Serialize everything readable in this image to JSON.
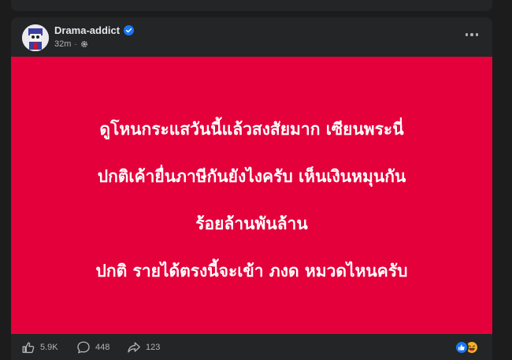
{
  "post": {
    "author": "Drama-addict",
    "time": "32m",
    "separator": "·",
    "content_lines": [
      "ดูโหนกระแสวันนี้แล้วสงสัยมาก เซียนพระนี่",
      "ปกติเค้ายื่นภาษีกันยังไงครับ เห็นเงินหมุนกัน",
      "ร้อยล้านพันล้าน",
      "ปกติ รายได้ตรงนี้จะเข้า ภงด หมวดไหนครับ"
    ],
    "background_color": "#e4003a",
    "reactions_count": "5.9K",
    "comments_count": "448",
    "shares_count": "123",
    "reaction_types": [
      "like-icon",
      "haha-icon"
    ]
  }
}
